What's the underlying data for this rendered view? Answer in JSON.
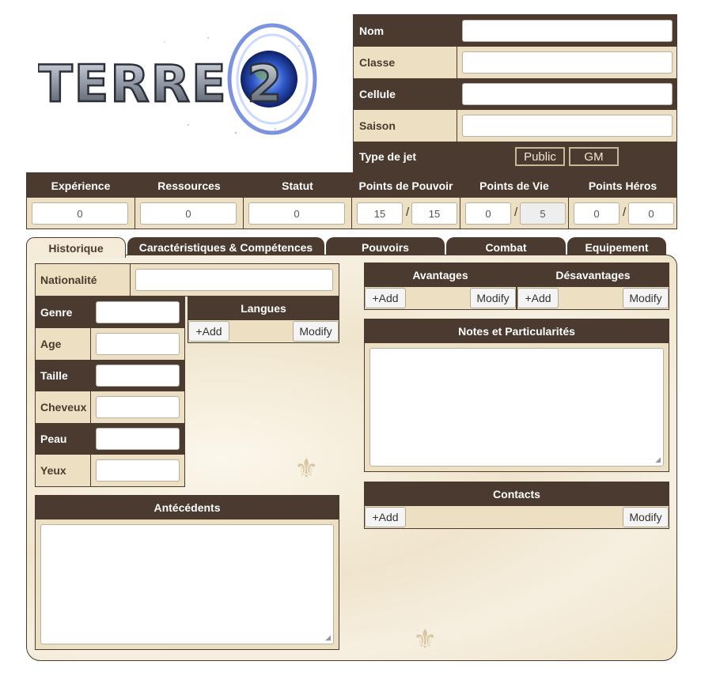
{
  "logo": {
    "text": "TERRE 2",
    "accent": "#3b5fc4"
  },
  "identity": {
    "rows": [
      {
        "label": "Nom",
        "value": ""
      },
      {
        "label": "Classe",
        "value": ""
      },
      {
        "label": "Cellule",
        "value": ""
      },
      {
        "label": "Saison",
        "value": ""
      }
    ],
    "jet": {
      "label": "Type de jet",
      "public": "Public",
      "gm": "GM"
    }
  },
  "stats": {
    "experience": {
      "label": "Expérience",
      "value": "0"
    },
    "ressources": {
      "label": "Ressources",
      "value": "0"
    },
    "statut": {
      "label": "Statut",
      "value": "0"
    },
    "pouvoir": {
      "label": "Points de Pouvoir",
      "current": "15",
      "max": "15"
    },
    "vie": {
      "label": "Points de Vie",
      "current": "0",
      "max": "5"
    },
    "heros": {
      "label": "Points Héros",
      "current": "0",
      "max": "0"
    },
    "separator": "/"
  },
  "tabs": [
    {
      "label": "Historique"
    },
    {
      "label": "Caractéristiques & Compétences"
    },
    {
      "label": "Pouvoirs"
    },
    {
      "label": "Combat"
    },
    {
      "label": "Equipement"
    }
  ],
  "historique": {
    "nationalite": {
      "label": "Nationalité",
      "value": ""
    },
    "perso": [
      {
        "label": "Genre",
        "value": ""
      },
      {
        "label": "Age",
        "value": ""
      },
      {
        "label": "Taille",
        "value": ""
      },
      {
        "label": "Cheveux",
        "value": ""
      },
      {
        "label": "Peau",
        "value": ""
      },
      {
        "label": "Yeux",
        "value": ""
      }
    ],
    "langues": {
      "title": "Langues",
      "add": "+Add",
      "modify": "Modify"
    },
    "antecedents": {
      "title": "Antécédents"
    },
    "avantages": {
      "title": "Avantages",
      "add": "+Add",
      "modify": "Modify"
    },
    "desavantages": {
      "title": "Désavantages",
      "add": "+Add",
      "modify": "Modify"
    },
    "notes": {
      "title": "Notes et Particularités"
    },
    "contacts": {
      "title": "Contacts",
      "add": "+Add",
      "modify": "Modify"
    }
  },
  "colors": {
    "dark": "#4b3a2f",
    "light": "#ede0c2"
  }
}
